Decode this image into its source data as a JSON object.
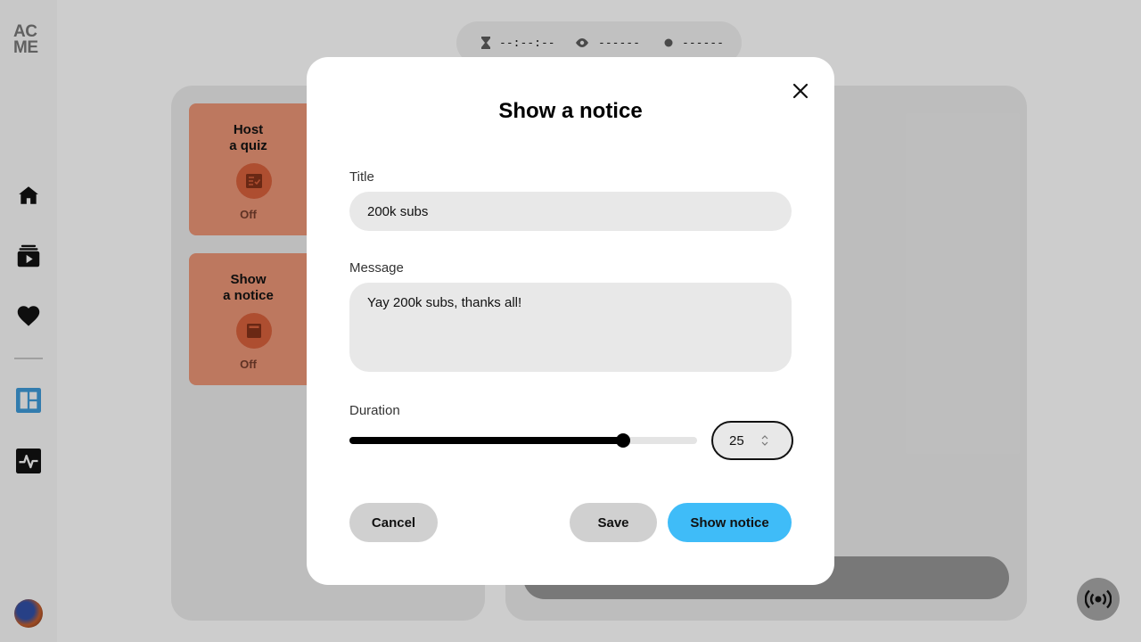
{
  "app": {
    "logo_line1": "AC",
    "logo_line2": "ME"
  },
  "sidebar": {
    "items": [
      {
        "icon": "home-icon"
      },
      {
        "icon": "video-library-icon"
      },
      {
        "icon": "heart-icon"
      },
      {
        "icon": "dashboard-icon",
        "active": true
      },
      {
        "icon": "activity-icon"
      }
    ]
  },
  "status": {
    "timer": "--:--:--",
    "viewers": "------",
    "live": "------"
  },
  "features": [
    {
      "title_line1": "Host",
      "title_line2": "a quiz",
      "state": "Off"
    },
    {
      "title_line1": "Show",
      "title_line2": "a notice",
      "state": "Off"
    }
  ],
  "modal": {
    "title": "Show a notice",
    "title_label": "Title",
    "title_value": "200k subs",
    "message_label": "Message",
    "message_value": "Yay 200k subs, thanks all!",
    "duration_label": "Duration",
    "duration_value": "25",
    "duration_fraction": 0.787,
    "cancel_label": "Cancel",
    "save_label": "Save",
    "show_label": "Show notice"
  },
  "colors": {
    "accent": "#3fbcf8",
    "card": "#d98a6e",
    "card_icon": "#c85a38",
    "dashboard_active": "#3a8fc8"
  }
}
